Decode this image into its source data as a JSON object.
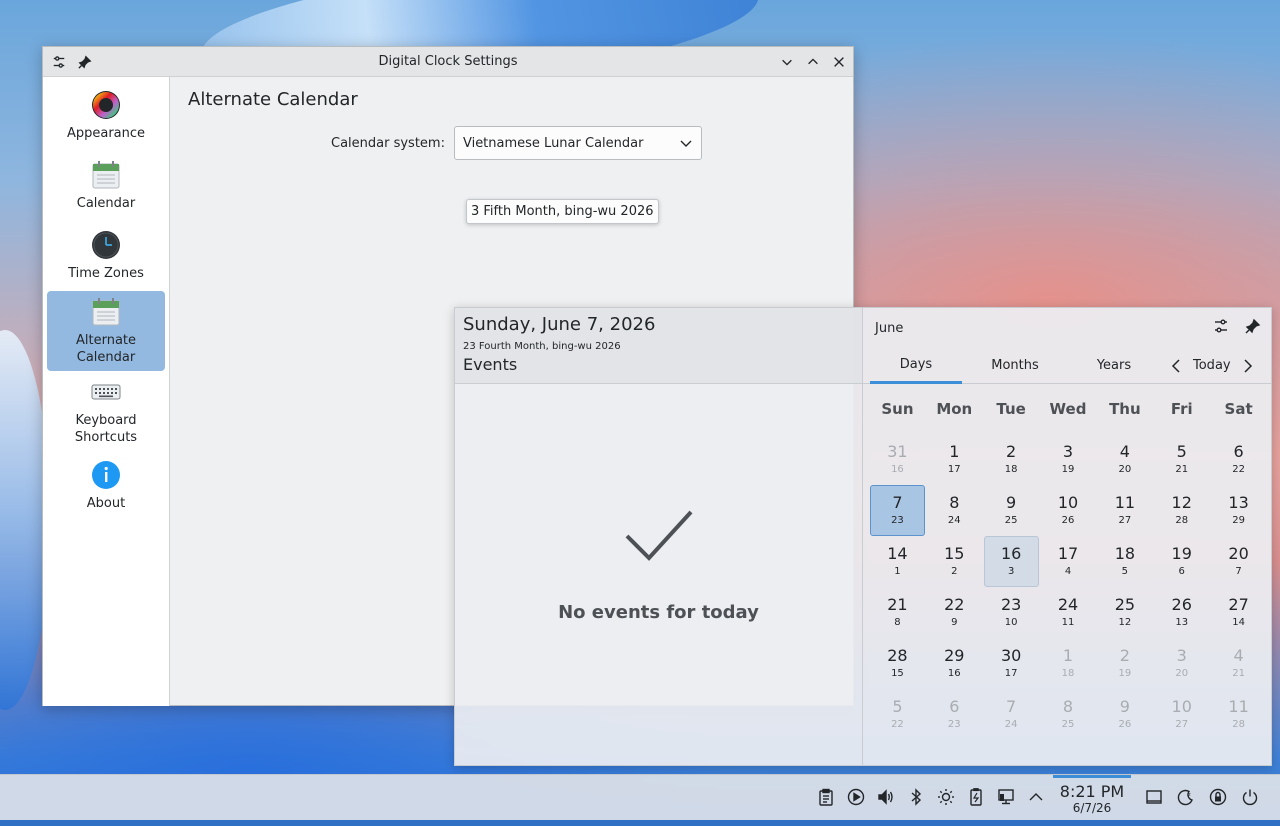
{
  "window": {
    "title": "Digital Clock Settings"
  },
  "sidebar": {
    "items": [
      {
        "label": "Appearance",
        "icon": "appearance-icon"
      },
      {
        "label": "Calendar",
        "icon": "calendar-icon"
      },
      {
        "label": "Time Zones",
        "icon": "clock-icon"
      },
      {
        "label": "Alternate Calendar",
        "icon": "calendar-icon",
        "active": true
      },
      {
        "label": "Keyboard Shortcuts",
        "icon": "keyboard-icon"
      },
      {
        "label": "About",
        "icon": "info-icon"
      }
    ]
  },
  "page": {
    "title": "Alternate Calendar",
    "calendar_system_label": "Calendar system:",
    "calendar_system_value": "Vietnamese Lunar Calendar"
  },
  "popup": {
    "date": "Sunday, June 7, 2026",
    "lunar_date": "23 Fourth Month, bing-wu 2026",
    "events_title": "Events",
    "no_events": "No events for today",
    "month": "June",
    "tabs": [
      "Days",
      "Months",
      "Years"
    ],
    "active_tab": "Days",
    "today_label": "Today",
    "weekdays": [
      "Sun",
      "Mon",
      "Tue",
      "Wed",
      "Thu",
      "Fri",
      "Sat"
    ],
    "weeks": [
      [
        {
          "d": "31",
          "l": "16",
          "other": true
        },
        {
          "d": "1",
          "l": "17"
        },
        {
          "d": "2",
          "l": "18"
        },
        {
          "d": "3",
          "l": "19"
        },
        {
          "d": "4",
          "l": "20"
        },
        {
          "d": "5",
          "l": "21"
        },
        {
          "d": "6",
          "l": "22"
        }
      ],
      [
        {
          "d": "7",
          "l": "23",
          "today": true
        },
        {
          "d": "8",
          "l": "24"
        },
        {
          "d": "9",
          "l": "25"
        },
        {
          "d": "10",
          "l": "26"
        },
        {
          "d": "11",
          "l": "27"
        },
        {
          "d": "12",
          "l": "28"
        },
        {
          "d": "13",
          "l": "29"
        }
      ],
      [
        {
          "d": "14",
          "l": "1"
        },
        {
          "d": "15",
          "l": "2"
        },
        {
          "d": "16",
          "l": "3",
          "hover": true
        },
        {
          "d": "17",
          "l": "4"
        },
        {
          "d": "18",
          "l": "5"
        },
        {
          "d": "19",
          "l": "6"
        },
        {
          "d": "20",
          "l": "7"
        }
      ],
      [
        {
          "d": "21",
          "l": "8"
        },
        {
          "d": "22",
          "l": "9"
        },
        {
          "d": "23",
          "l": "10"
        },
        {
          "d": "24",
          "l": "11"
        },
        {
          "d": "25",
          "l": "12"
        },
        {
          "d": "26",
          "l": "13"
        },
        {
          "d": "27",
          "l": "14"
        }
      ],
      [
        {
          "d": "28",
          "l": "15"
        },
        {
          "d": "29",
          "l": "16"
        },
        {
          "d": "30",
          "l": "17"
        },
        {
          "d": "1",
          "l": "18",
          "other": true
        },
        {
          "d": "2",
          "l": "19",
          "other": true
        },
        {
          "d": "3",
          "l": "20",
          "other": true
        },
        {
          "d": "4",
          "l": "21",
          "other": true
        }
      ],
      [
        {
          "d": "5",
          "l": "22",
          "other": true
        },
        {
          "d": "6",
          "l": "23",
          "other": true
        },
        {
          "d": "7",
          "l": "24",
          "other": true
        },
        {
          "d": "8",
          "l": "25",
          "other": true
        },
        {
          "d": "9",
          "l": "26",
          "other": true
        },
        {
          "d": "10",
          "l": "27",
          "other": true
        },
        {
          "d": "11",
          "l": "28",
          "other": true
        }
      ]
    ],
    "tooltip": "3 Fifth Month, bing-wu 2026"
  },
  "panel": {
    "time": "8:21 PM",
    "date": "6/7/26",
    "tray_icons": [
      "clipboard-icon",
      "media-play-icon",
      "volume-icon",
      "bluetooth-icon",
      "brightness-icon",
      "battery-icon",
      "network-icon",
      "expand-tray-icon"
    ],
    "right_icons": [
      "show-desktop-icon",
      "night-mode-icon",
      "lock-icon",
      "power-icon"
    ]
  },
  "colors": {
    "accent": "#3d8ed8",
    "sidebar_active": "#93b9e0"
  }
}
